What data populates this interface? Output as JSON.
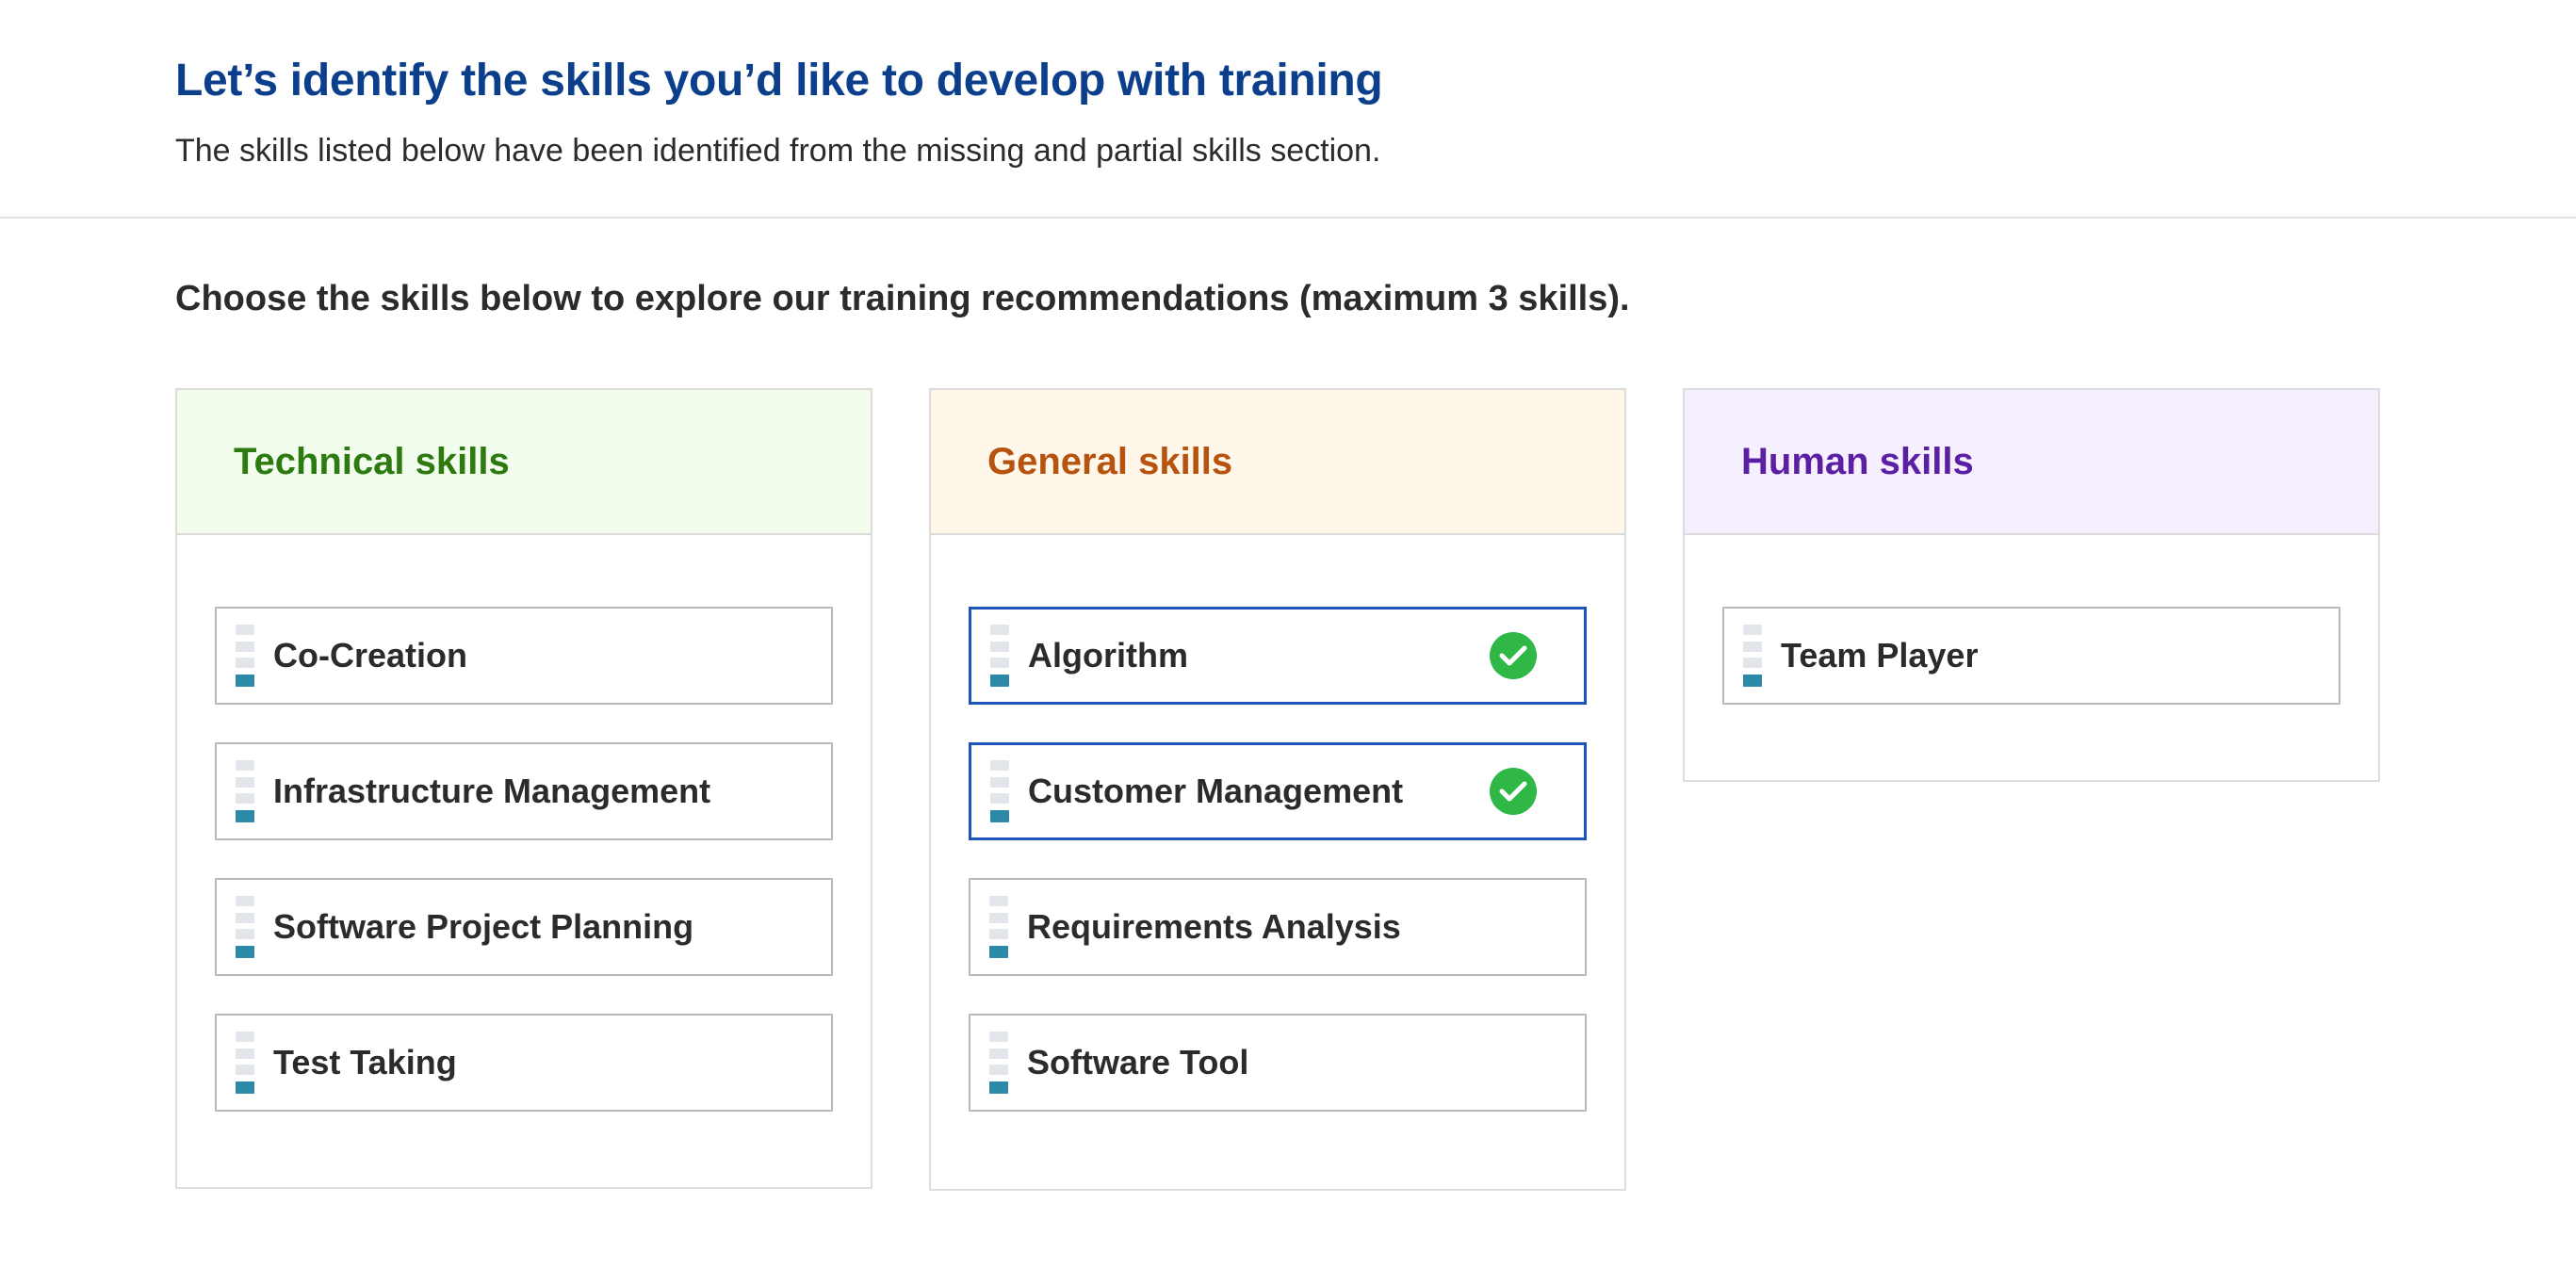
{
  "header": {
    "title": "Let’s identify the skills you’d like to develop with training",
    "subtitle": "The skills listed below have been identified from the missing and partial skills section."
  },
  "instruction": "Choose the skills below to explore our training recommendations (maximum 3 skills).",
  "colors": {
    "title": "#0b3f8c",
    "technical_head_bg": "#f2fdee",
    "technical_head_text": "#2c7a10",
    "general_head_bg": "#fff7ea",
    "general_head_text": "#b5530f",
    "human_head_bg": "#f6effd",
    "human_head_text": "#5a1fa3",
    "selected_border": "#1e56b5",
    "check": "#2fb845",
    "level_fill": "#2c8aa8"
  },
  "categories": {
    "technical": {
      "label": "Technical skills",
      "skills": [
        {
          "label": "Co-Creation",
          "selected": false,
          "level_icon": "skill-level-icon"
        },
        {
          "label": "Infrastructure Management",
          "selected": false,
          "level_icon": "skill-level-icon"
        },
        {
          "label": "Software Project Planning",
          "selected": false,
          "level_icon": "skill-level-icon"
        },
        {
          "label": "Test Taking",
          "selected": false,
          "level_icon": "skill-level-icon"
        }
      ]
    },
    "general": {
      "label": "General skills",
      "skills": [
        {
          "label": "Algorithm",
          "selected": true,
          "level_icon": "skill-level-icon",
          "check_icon": "check-circle-icon"
        },
        {
          "label": "Customer Management",
          "selected": true,
          "level_icon": "skill-level-icon",
          "check_icon": "check-circle-icon"
        },
        {
          "label": "Requirements Analysis",
          "selected": false,
          "level_icon": "skill-level-icon"
        },
        {
          "label": "Software Tool",
          "selected": false,
          "level_icon": "skill-level-icon"
        }
      ]
    },
    "human": {
      "label": "Human skills",
      "skills": [
        {
          "label": "Team Player",
          "selected": false,
          "level_icon": "skill-level-icon"
        }
      ]
    }
  }
}
